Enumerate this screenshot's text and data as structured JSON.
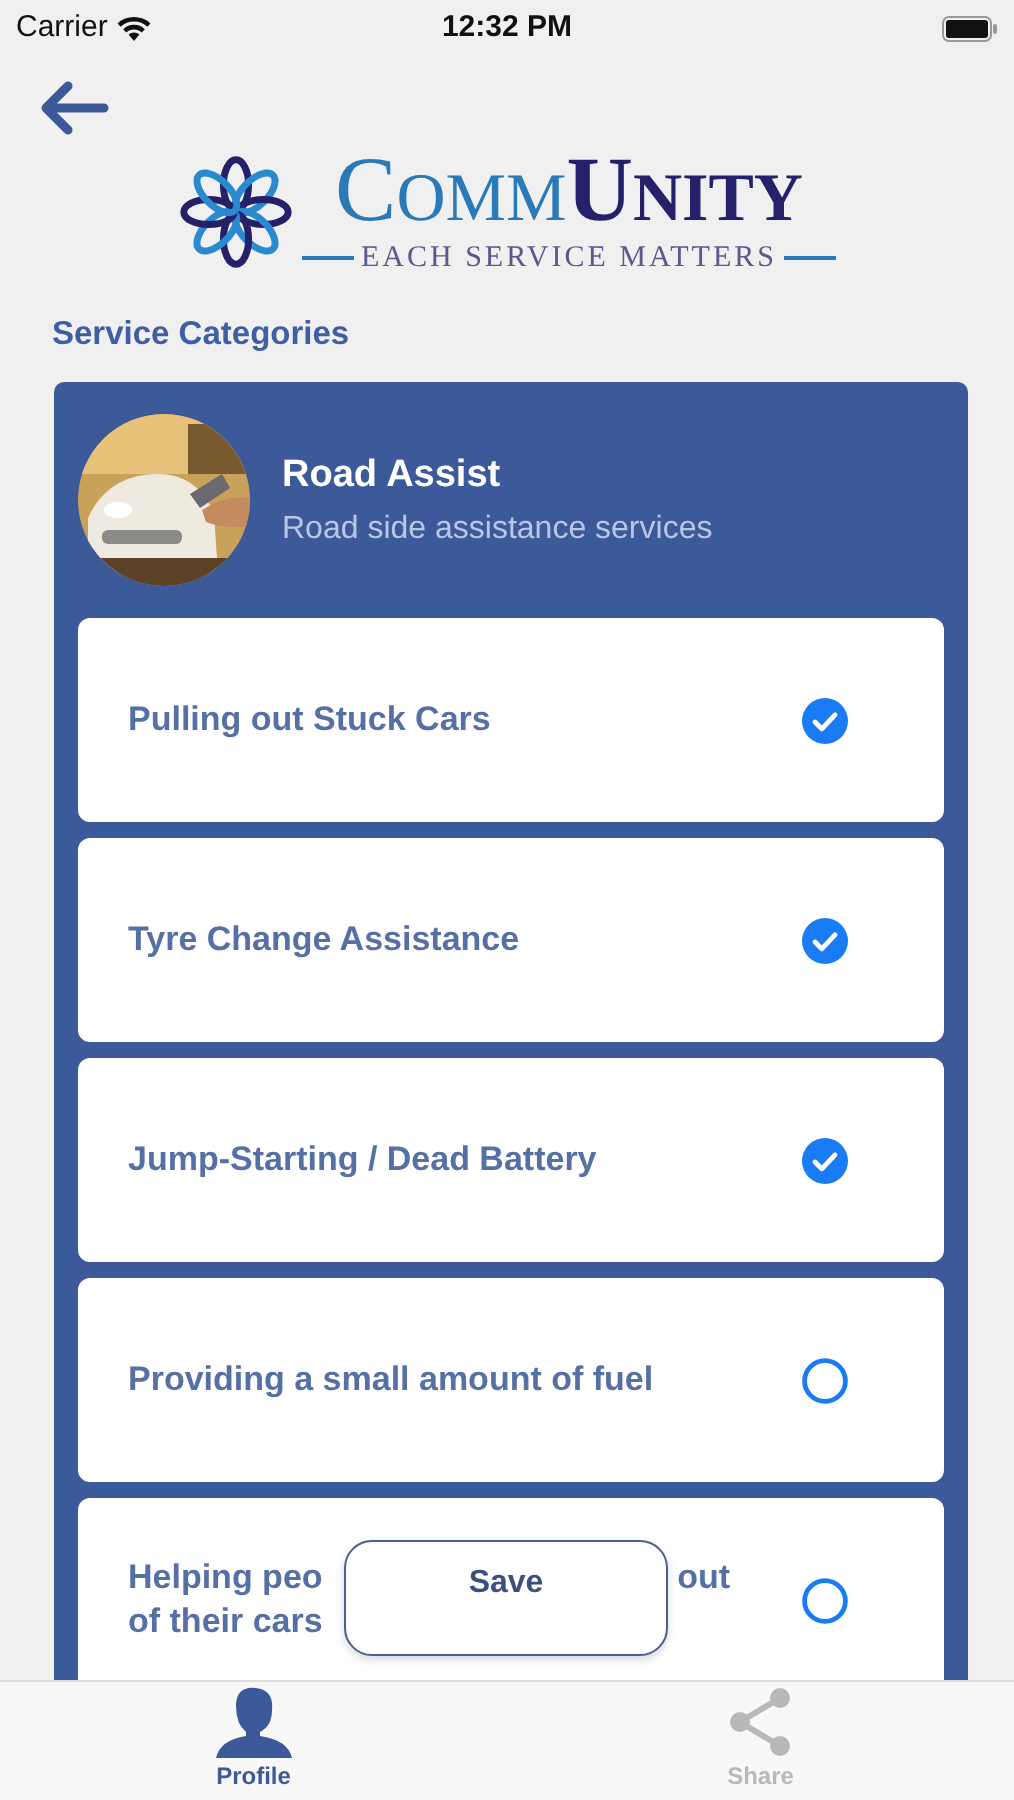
{
  "status_bar": {
    "carrier": "Carrier",
    "time": "12:32 PM"
  },
  "logo": {
    "word_light": "COMM",
    "word_bold": "UNITY",
    "tagline": "EACH SERVICE MATTERS"
  },
  "section_title": "Service Categories",
  "category": {
    "title": "Road Assist",
    "subtitle": "Road side assistance services"
  },
  "services": [
    {
      "text_parts": [
        "Pulling out Stuck Cars"
      ],
      "checked": true
    },
    {
      "text_parts": [
        "Tyre Change Assistance"
      ],
      "checked": true
    },
    {
      "text_parts": [
        "Jump-Starting / Dead Battery"
      ],
      "checked": true
    },
    {
      "text_parts": [
        "Providing a small amount of fuel"
      ],
      "checked": false
    },
    {
      "text_parts": [
        "Helping peo",
        "out",
        "of their cars"
      ],
      "checked": false
    }
  ],
  "save_button": "Save",
  "tab_bar": [
    {
      "label": "Profile",
      "kind": "person",
      "selected": true
    },
    {
      "label": "Share",
      "kind": "share",
      "selected": false
    }
  ]
}
